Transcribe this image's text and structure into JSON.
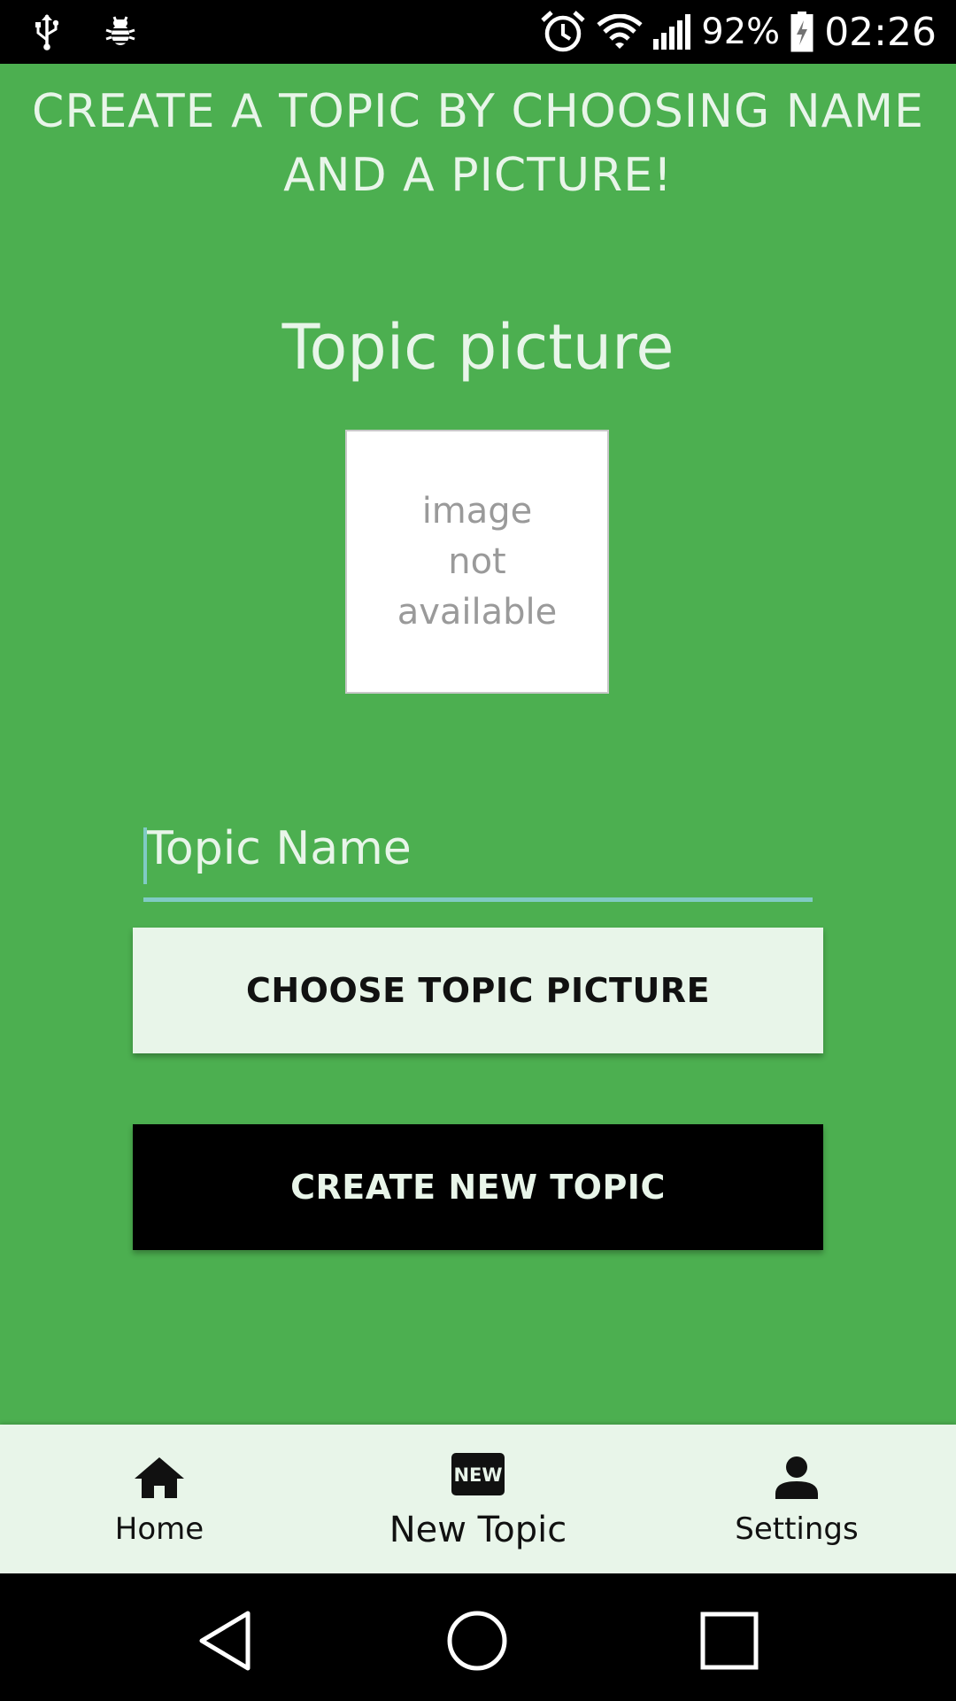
{
  "status_bar": {
    "left_icons": [
      "usb-icon",
      "bug-icon"
    ],
    "right_icons": [
      "alarm-icon",
      "wifi-icon",
      "signal-icon",
      "battery-charging-icon"
    ],
    "battery": "92%",
    "time": "02:26"
  },
  "screen": {
    "headline": "CREATE A TOPIC BY CHOOSING NAME AND A PICTURE!",
    "section_title": "Topic picture",
    "image_placeholder": [
      "image",
      "not",
      "available"
    ],
    "name_field": {
      "placeholder": "Topic Name",
      "value": ""
    },
    "choose_button": "CHOOSE TOPIC PICTURE",
    "create_button": "CREATE NEW TOPIC"
  },
  "bottom_nav": {
    "items": [
      {
        "label": "Home",
        "icon": "home-icon",
        "active": false
      },
      {
        "label": "New Topic",
        "icon": "new-badge-icon",
        "active": true
      },
      {
        "label": "Settings",
        "icon": "person-icon",
        "active": false
      }
    ],
    "new_badge_text": "NEW"
  },
  "system_nav": {
    "icons": [
      "back-icon",
      "home-circle-icon",
      "recents-icon"
    ]
  },
  "colors": {
    "background": "#4caf50",
    "light_text": "#e8f5e9",
    "accent": "#80cbc4",
    "nav_background": "#e8f5e9",
    "dark": "#000000"
  }
}
